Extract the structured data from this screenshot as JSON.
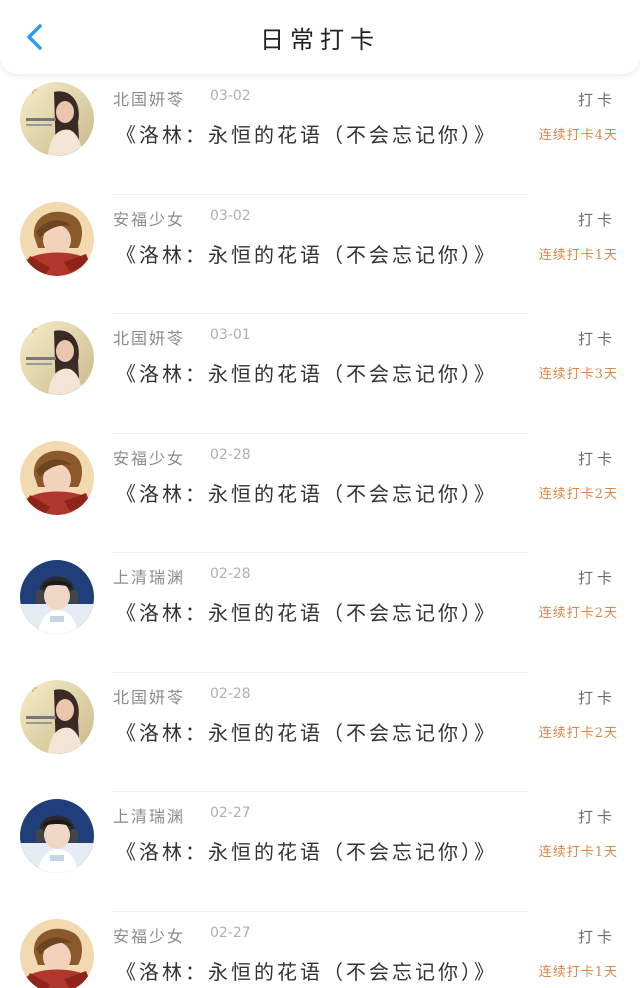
{
  "header": {
    "title": "日常打卡",
    "back_icon": "chevron-left-icon",
    "accent_color": "#2f9bef"
  },
  "list": {
    "items": [
      {
        "user": "北国妍苓",
        "date": "03-02",
        "book": "《洛林：永恒的花语（不会忘记你）》",
        "action": "打卡",
        "streak": "连续打卡4天",
        "avatar": "girl-photo"
      },
      {
        "user": "安福少女",
        "date": "03-02",
        "book": "《洛林：永恒的花语（不会忘记你）》",
        "action": "打卡",
        "streak": "连续打卡1天",
        "avatar": "scarf-boy"
      },
      {
        "user": "北国妍苓",
        "date": "03-01",
        "book": "《洛林：永恒的花语（不会忘记你）》",
        "action": "打卡",
        "streak": "连续打卡3天",
        "avatar": "girl-photo"
      },
      {
        "user": "安福少女",
        "date": "02-28",
        "book": "《洛林：永恒的花语（不会忘记你）》",
        "action": "打卡",
        "streak": "连续打卡2天",
        "avatar": "scarf-boy"
      },
      {
        "user": "上清瑞渊",
        "date": "02-28",
        "book": "《洛林：永恒的花语（不会忘记你）》",
        "action": "打卡",
        "streak": "连续打卡2天",
        "avatar": "headphone-boy"
      },
      {
        "user": "北国妍苓",
        "date": "02-28",
        "book": "《洛林：永恒的花语（不会忘记你）》",
        "action": "打卡",
        "streak": "连续打卡2天",
        "avatar": "girl-photo"
      },
      {
        "user": "上清瑞渊",
        "date": "02-27",
        "book": "《洛林：永恒的花语（不会忘记你）》",
        "action": "打卡",
        "streak": "连续打卡1天",
        "avatar": "headphone-boy"
      },
      {
        "user": "安福少女",
        "date": "02-27",
        "book": "《洛林：永恒的花语（不会忘记你）》",
        "action": "打卡",
        "streak": "连续打卡1天",
        "avatar": "scarf-boy"
      }
    ]
  }
}
